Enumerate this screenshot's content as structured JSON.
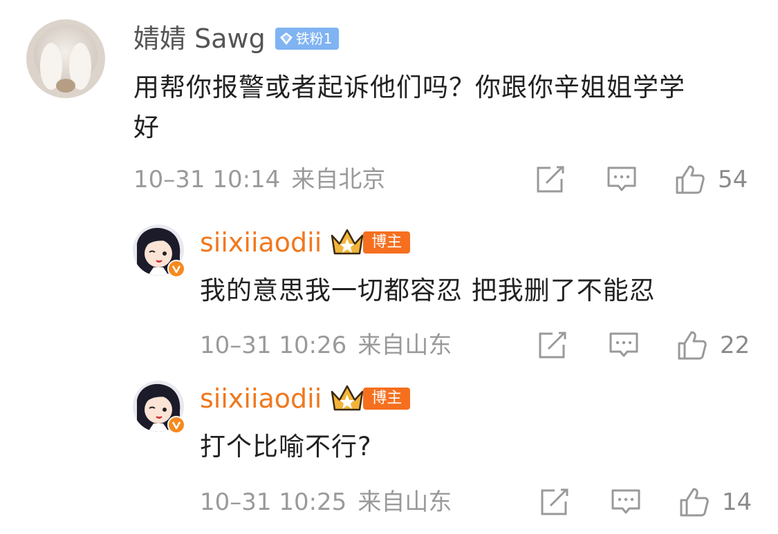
{
  "comments": [
    {
      "username": "婧婧 Sawg",
      "badge": "铁粉1",
      "text_line1": "用帮你报警或者起诉他们吗？你跟你辛姐姐学学",
      "text_line2": "好",
      "time": "10–31 10:14",
      "location": "来自北京",
      "likes": "54",
      "avatar_icon": "white-rabbit-avatar"
    },
    {
      "username": "siixiiaodii",
      "badge": "博主",
      "text_line1": "我的意思我一切都容忍 把我删了不能忍",
      "time": "10–31 10:26",
      "location": "来自山东",
      "likes": "22",
      "avatar_icon": "anime-girl-avatar"
    },
    {
      "username": "siixiiaodii",
      "badge": "博主",
      "text_line1": "打个比喻不行?",
      "time": "10–31 10:25",
      "location": "来自山东",
      "likes": "14",
      "avatar_icon": "anime-girl-avatar"
    }
  ],
  "colors": {
    "orange": "#f0781e",
    "host_badge": "#f56f1f",
    "fan_badge": "#7fb3f2",
    "meta_gray": "#9a9a9a"
  },
  "icons": {
    "repost": "share-edit-icon",
    "comment": "comment-bubble-icon",
    "like": "thumbs-up-icon"
  }
}
